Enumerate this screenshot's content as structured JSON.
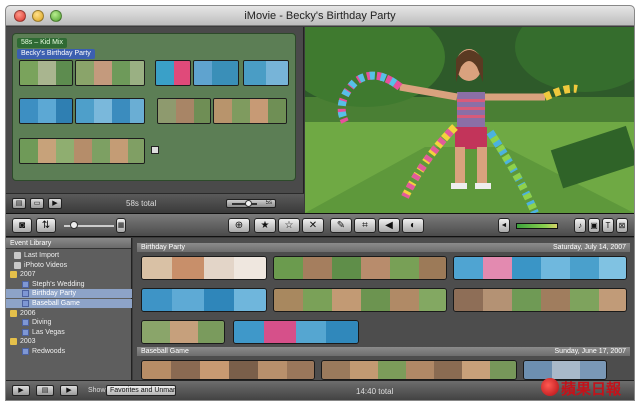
{
  "window": {
    "title": "iMovie - Becky's Birthday Party"
  },
  "project": {
    "music_label": "58s – Kid Mix",
    "title_label": "Becky's Birthday Party",
    "total": "58s total",
    "zoom_label": "5s"
  },
  "toolbar": {
    "buttons": [
      "camera-icon",
      "swap-icon",
      "add-icon",
      "favorite-icon",
      "unmark-icon",
      "reject-icon",
      "keyword-icon",
      "crop-icon",
      "audio-icon",
      "adjust-icon",
      "music-icon",
      "photo-icon",
      "title-icon",
      "transition-icon"
    ]
  },
  "library": {
    "header": "Event Library",
    "items": [
      {
        "label": "Last Import",
        "indent": 1,
        "type": "star"
      },
      {
        "label": "iPhoto Videos",
        "indent": 1,
        "type": "star"
      },
      {
        "label": "2007",
        "indent": 0,
        "type": "folder"
      },
      {
        "label": "Steph's Wedding",
        "indent": 2,
        "type": "event"
      },
      {
        "label": "Birthday Party",
        "indent": 2,
        "type": "event",
        "selected": true
      },
      {
        "label": "Baseball Game",
        "indent": 2,
        "type": "event",
        "selected": true
      },
      {
        "label": "2006",
        "indent": 0,
        "type": "folder"
      },
      {
        "label": "Diving",
        "indent": 2,
        "type": "event"
      },
      {
        "label": "Las Vegas",
        "indent": 2,
        "type": "event"
      },
      {
        "label": "2003",
        "indent": 0,
        "type": "folder"
      },
      {
        "label": "Redwoods",
        "indent": 2,
        "type": "event"
      }
    ]
  },
  "events": [
    {
      "name": "Birthday Party",
      "date": "Saturday, July 14, 2007"
    },
    {
      "name": "Baseball Game",
      "date": "Sunday, June 17, 2007"
    }
  ],
  "bottom": {
    "show_label": "Show:",
    "show_value": "Favorites and Unmarked",
    "total": "14:40 total"
  },
  "watermark": {
    "text": "蘋果日報"
  },
  "colors": {
    "project_green": "#5c7e55",
    "selection_blue": "#8da3c8",
    "chrome_dark": "#3b3b3b"
  }
}
